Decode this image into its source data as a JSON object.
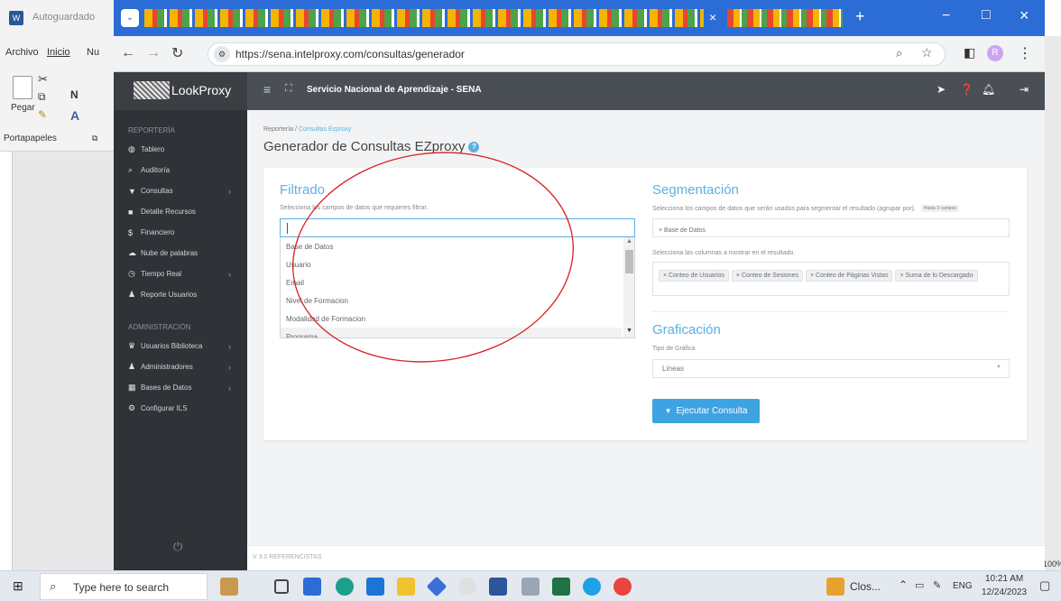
{
  "word": {
    "autosave_label": "Autoguardado",
    "tabs": [
      "Archivo",
      "Inicio",
      "Nu"
    ],
    "paste_label": "Pegar",
    "clipboard_label": "Portapapeles",
    "font_bold": "N",
    "zoom_percent": "100%"
  },
  "browser": {
    "active_tab_close": "×",
    "new_tab": "+",
    "url": "https://sena.intelproxy.com/consultas/generador",
    "profile_initial": "R",
    "win_min": "−",
    "win_max": "□",
    "win_close": "×"
  },
  "app": {
    "logo_text": "LookProxy",
    "org_title": "Servicio Nacional de Aprendizaje - SENA"
  },
  "sidebar": {
    "section1": "REPORTERÍA",
    "items1": [
      {
        "icon": "dashboard-icon",
        "glyph": "◍",
        "label": "Tablero",
        "chevron": false
      },
      {
        "icon": "audit-icon",
        "glyph": "⌕",
        "label": "Auditoría",
        "chevron": false
      },
      {
        "icon": "filter-icon",
        "glyph": "▼",
        "label": "Consultas",
        "chevron": true
      },
      {
        "icon": "bookmark-icon",
        "glyph": "■",
        "label": "Detalle Recursos",
        "chevron": false
      },
      {
        "icon": "dollar-icon",
        "glyph": "$",
        "label": "Financiero",
        "chevron": false
      },
      {
        "icon": "cloud-icon",
        "glyph": "☁",
        "label": "Nube de palabras",
        "chevron": false
      },
      {
        "icon": "clock-icon",
        "glyph": "◷",
        "label": "Tiempo Real",
        "chevron": true
      },
      {
        "icon": "user-icon",
        "glyph": "♟",
        "label": "Reporte Usuarios",
        "chevron": false
      }
    ],
    "section2": "ADMINISTRACIÓN",
    "items2": [
      {
        "icon": "users-icon",
        "glyph": "♛",
        "label": "Usuarios Biblioteca",
        "chevron": true
      },
      {
        "icon": "admin-icon",
        "glyph": "♟",
        "label": "Administradores",
        "chevron": true
      },
      {
        "icon": "database-icon",
        "glyph": "▦",
        "label": "Bases de Datos",
        "chevron": true
      },
      {
        "icon": "cogs-icon",
        "glyph": "⚙",
        "label": "Configurar ILS",
        "chevron": false
      }
    ],
    "power_glyph": "⏻"
  },
  "page": {
    "breadcrumb_root": "Reportería",
    "breadcrumb_sep": "/",
    "breadcrumb_current": "Consultas Ezproxy",
    "title": "Generador de Consultas EZproxy",
    "footer": "V 3.0 REFERENCISTAS"
  },
  "filtrado": {
    "title": "Filtrado",
    "hint": "Selecciona los campos de datos que requieres filtrar.",
    "options": [
      "Base de Datos",
      "Usuario",
      "Email",
      "Nivel de Formacion",
      "Modalidad de Formacion",
      "Programa"
    ]
  },
  "segmentacion": {
    "title": "Segmentación",
    "hint": "Selecciona los campos de datos que serán usados para segmentar el resultado (agrupar por).",
    "limit_badge": "Hasta 3 campos",
    "selected": [
      "× Base de Datos"
    ],
    "columns_hint": "Selecciona las columnas a mostrar en el resultado.",
    "columns": [
      "× Conteo de Usuarios",
      "× Conteo de Sesiones",
      "× Conteo de Páginas Vistas",
      "× Suma de lo Descargado"
    ]
  },
  "graficacion": {
    "title": "Graficación",
    "type_label": "Tipo de Gráfica",
    "type_value": "Líneas",
    "run_button": "Ejecutar Consulta"
  },
  "taskbar": {
    "search_placeholder": "Type here to search",
    "running_app": "Clos...",
    "lang": "ENG",
    "time": "10:21 AM",
    "date": "12/24/2023"
  }
}
